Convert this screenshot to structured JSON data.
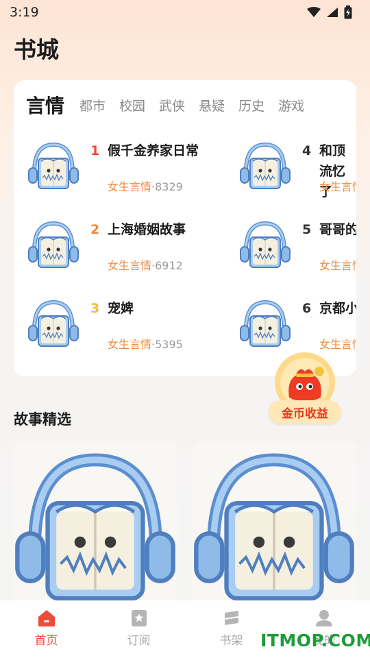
{
  "status_bar": {
    "time": "3:19"
  },
  "header": {
    "title": "书城"
  },
  "category_tabs": [
    {
      "label": "言情",
      "active": true
    },
    {
      "label": "都市"
    },
    {
      "label": "校园"
    },
    {
      "label": "武侠"
    },
    {
      "label": "悬疑"
    },
    {
      "label": "历史"
    },
    {
      "label": "游戏"
    }
  ],
  "rank_list": [
    {
      "rank": "1",
      "title": "假千金养家日常",
      "category": "女生言情",
      "separator": "·",
      "count": "8329",
      "rank_color": "#e94b3c"
    },
    {
      "rank": "2",
      "title": "上海婚姻故事",
      "category": "女生言情",
      "separator": "·",
      "count": "6912",
      "rank_color": "#f08a3a"
    },
    {
      "rank": "3",
      "title": "宠婢",
      "category": "女生言情",
      "separator": "·",
      "count": "5395",
      "rank_color": "#f5b942"
    },
    {
      "rank": "4",
      "title": "和顶流忆了",
      "category": "女生言情",
      "separator": "",
      "count": "",
      "rank_color": "#333333"
    },
    {
      "rank": "5",
      "title": "哥哥的",
      "category": "女生言情",
      "separator": "",
      "count": "",
      "rank_color": "#333333"
    },
    {
      "rank": "6",
      "title": "京都小",
      "category": "女生言情",
      "separator": "",
      "count": "",
      "rank_color": "#333333"
    }
  ],
  "coin_badge": {
    "label": "金币收益"
  },
  "featured": {
    "title": "故事精选"
  },
  "bottom_nav": [
    {
      "label": "首页",
      "icon": "home-icon",
      "active": true
    },
    {
      "label": "订阅",
      "icon": "bookmark-star-icon"
    },
    {
      "label": "书架",
      "icon": "bookshelf-icon"
    },
    {
      "label": "我的",
      "icon": "profile-icon"
    }
  ],
  "watermark": {
    "text": "ITMOP.COM"
  },
  "colors": {
    "accent": "#ef4b3a",
    "category": "#ee8a3c",
    "muted": "#9a9a9a"
  }
}
